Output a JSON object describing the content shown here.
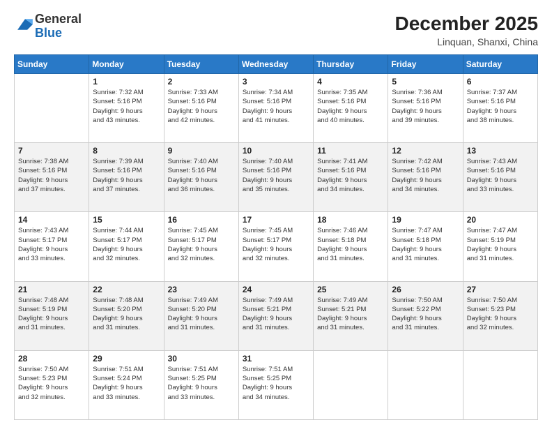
{
  "header": {
    "logo": {
      "general": "General",
      "blue": "Blue"
    },
    "title": "December 2025",
    "location": "Linquan, Shanxi, China"
  },
  "calendar": {
    "days_of_week": [
      "Sunday",
      "Monday",
      "Tuesday",
      "Wednesday",
      "Thursday",
      "Friday",
      "Saturday"
    ],
    "weeks": [
      [
        {
          "day": "",
          "sunrise": "",
          "sunset": "",
          "daylight": ""
        },
        {
          "day": "1",
          "sunrise": "Sunrise: 7:32 AM",
          "sunset": "Sunset: 5:16 PM",
          "daylight": "Daylight: 9 hours and 43 minutes."
        },
        {
          "day": "2",
          "sunrise": "Sunrise: 7:33 AM",
          "sunset": "Sunset: 5:16 PM",
          "daylight": "Daylight: 9 hours and 42 minutes."
        },
        {
          "day": "3",
          "sunrise": "Sunrise: 7:34 AM",
          "sunset": "Sunset: 5:16 PM",
          "daylight": "Daylight: 9 hours and 41 minutes."
        },
        {
          "day": "4",
          "sunrise": "Sunrise: 7:35 AM",
          "sunset": "Sunset: 5:16 PM",
          "daylight": "Daylight: 9 hours and 40 minutes."
        },
        {
          "day": "5",
          "sunrise": "Sunrise: 7:36 AM",
          "sunset": "Sunset: 5:16 PM",
          "daylight": "Daylight: 9 hours and 39 minutes."
        },
        {
          "day": "6",
          "sunrise": "Sunrise: 7:37 AM",
          "sunset": "Sunset: 5:16 PM",
          "daylight": "Daylight: 9 hours and 38 minutes."
        }
      ],
      [
        {
          "day": "7",
          "sunrise": "Sunrise: 7:38 AM",
          "sunset": "Sunset: 5:16 PM",
          "daylight": "Daylight: 9 hours and 37 minutes."
        },
        {
          "day": "8",
          "sunrise": "Sunrise: 7:39 AM",
          "sunset": "Sunset: 5:16 PM",
          "daylight": "Daylight: 9 hours and 37 minutes."
        },
        {
          "day": "9",
          "sunrise": "Sunrise: 7:40 AM",
          "sunset": "Sunset: 5:16 PM",
          "daylight": "Daylight: 9 hours and 36 minutes."
        },
        {
          "day": "10",
          "sunrise": "Sunrise: 7:40 AM",
          "sunset": "Sunset: 5:16 PM",
          "daylight": "Daylight: 9 hours and 35 minutes."
        },
        {
          "day": "11",
          "sunrise": "Sunrise: 7:41 AM",
          "sunset": "Sunset: 5:16 PM",
          "daylight": "Daylight: 9 hours and 34 minutes."
        },
        {
          "day": "12",
          "sunrise": "Sunrise: 7:42 AM",
          "sunset": "Sunset: 5:16 PM",
          "daylight": "Daylight: 9 hours and 34 minutes."
        },
        {
          "day": "13",
          "sunrise": "Sunrise: 7:43 AM",
          "sunset": "Sunset: 5:16 PM",
          "daylight": "Daylight: 9 hours and 33 minutes."
        }
      ],
      [
        {
          "day": "14",
          "sunrise": "Sunrise: 7:43 AM",
          "sunset": "Sunset: 5:17 PM",
          "daylight": "Daylight: 9 hours and 33 minutes."
        },
        {
          "day": "15",
          "sunrise": "Sunrise: 7:44 AM",
          "sunset": "Sunset: 5:17 PM",
          "daylight": "Daylight: 9 hours and 32 minutes."
        },
        {
          "day": "16",
          "sunrise": "Sunrise: 7:45 AM",
          "sunset": "Sunset: 5:17 PM",
          "daylight": "Daylight: 9 hours and 32 minutes."
        },
        {
          "day": "17",
          "sunrise": "Sunrise: 7:45 AM",
          "sunset": "Sunset: 5:17 PM",
          "daylight": "Daylight: 9 hours and 32 minutes."
        },
        {
          "day": "18",
          "sunrise": "Sunrise: 7:46 AM",
          "sunset": "Sunset: 5:18 PM",
          "daylight": "Daylight: 9 hours and 31 minutes."
        },
        {
          "day": "19",
          "sunrise": "Sunrise: 7:47 AM",
          "sunset": "Sunset: 5:18 PM",
          "daylight": "Daylight: 9 hours and 31 minutes."
        },
        {
          "day": "20",
          "sunrise": "Sunrise: 7:47 AM",
          "sunset": "Sunset: 5:19 PM",
          "daylight": "Daylight: 9 hours and 31 minutes."
        }
      ],
      [
        {
          "day": "21",
          "sunrise": "Sunrise: 7:48 AM",
          "sunset": "Sunset: 5:19 PM",
          "daylight": "Daylight: 9 hours and 31 minutes."
        },
        {
          "day": "22",
          "sunrise": "Sunrise: 7:48 AM",
          "sunset": "Sunset: 5:20 PM",
          "daylight": "Daylight: 9 hours and 31 minutes."
        },
        {
          "day": "23",
          "sunrise": "Sunrise: 7:49 AM",
          "sunset": "Sunset: 5:20 PM",
          "daylight": "Daylight: 9 hours and 31 minutes."
        },
        {
          "day": "24",
          "sunrise": "Sunrise: 7:49 AM",
          "sunset": "Sunset: 5:21 PM",
          "daylight": "Daylight: 9 hours and 31 minutes."
        },
        {
          "day": "25",
          "sunrise": "Sunrise: 7:49 AM",
          "sunset": "Sunset: 5:21 PM",
          "daylight": "Daylight: 9 hours and 31 minutes."
        },
        {
          "day": "26",
          "sunrise": "Sunrise: 7:50 AM",
          "sunset": "Sunset: 5:22 PM",
          "daylight": "Daylight: 9 hours and 31 minutes."
        },
        {
          "day": "27",
          "sunrise": "Sunrise: 7:50 AM",
          "sunset": "Sunset: 5:23 PM",
          "daylight": "Daylight: 9 hours and 32 minutes."
        }
      ],
      [
        {
          "day": "28",
          "sunrise": "Sunrise: 7:50 AM",
          "sunset": "Sunset: 5:23 PM",
          "daylight": "Daylight: 9 hours and 32 minutes."
        },
        {
          "day": "29",
          "sunrise": "Sunrise: 7:51 AM",
          "sunset": "Sunset: 5:24 PM",
          "daylight": "Daylight: 9 hours and 33 minutes."
        },
        {
          "day": "30",
          "sunrise": "Sunrise: 7:51 AM",
          "sunset": "Sunset: 5:25 PM",
          "daylight": "Daylight: 9 hours and 33 minutes."
        },
        {
          "day": "31",
          "sunrise": "Sunrise: 7:51 AM",
          "sunset": "Sunset: 5:25 PM",
          "daylight": "Daylight: 9 hours and 34 minutes."
        },
        {
          "day": "",
          "sunrise": "",
          "sunset": "",
          "daylight": ""
        },
        {
          "day": "",
          "sunrise": "",
          "sunset": "",
          "daylight": ""
        },
        {
          "day": "",
          "sunrise": "",
          "sunset": "",
          "daylight": ""
        }
      ]
    ]
  }
}
